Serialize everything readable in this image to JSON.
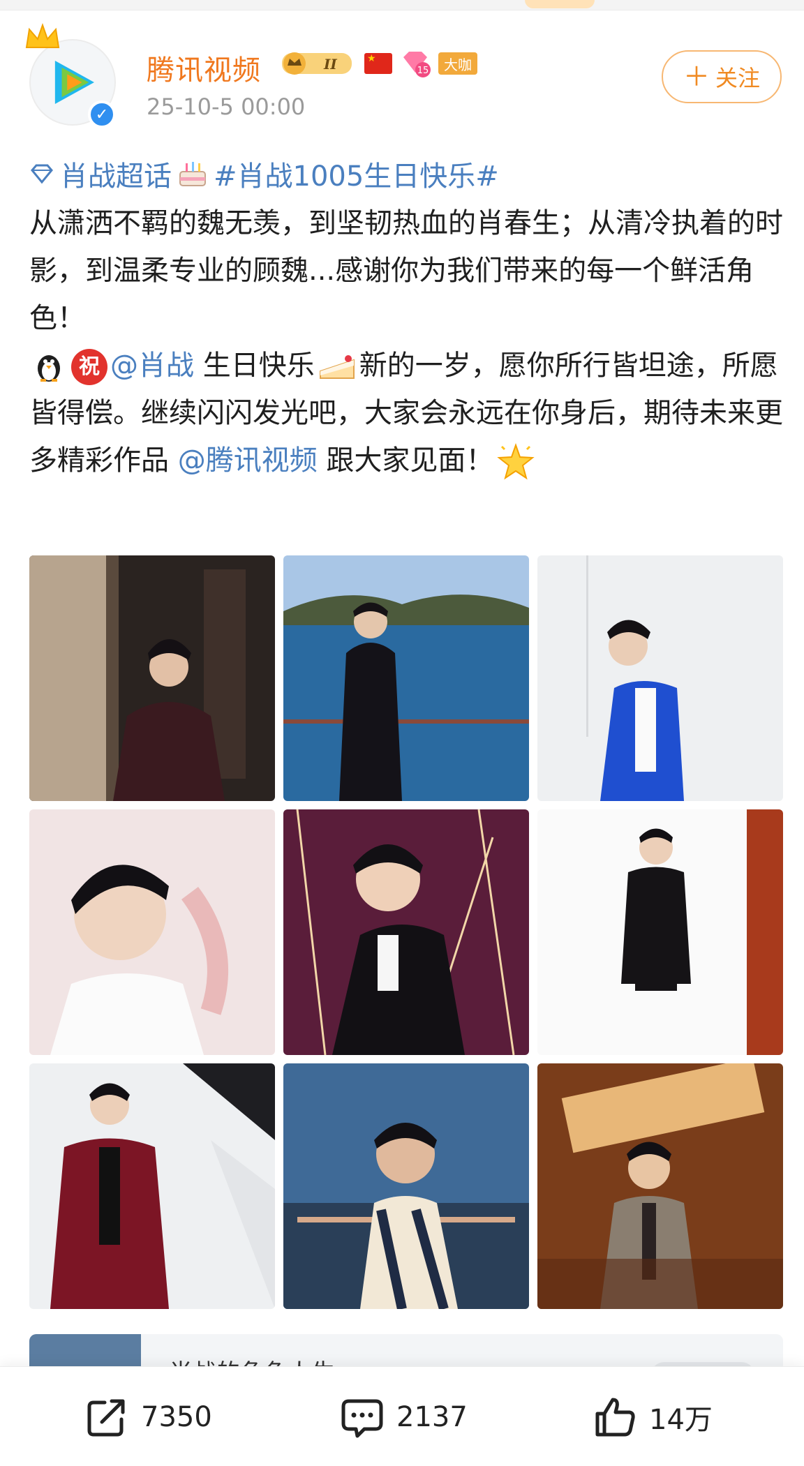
{
  "author": {
    "name": "腾讯视频",
    "post_time": "25-10-5 00:00",
    "badge_level": "II",
    "badge_diamond_count": "15",
    "badge_daka": "大咖"
  },
  "follow_button": {
    "label": "关注",
    "plus": "＋"
  },
  "post": {
    "tag_topic": "肖战超话",
    "hashtag": "#肖战1005生日快乐#",
    "paragraph1": "从潇洒不羁的魏无羡，到坚韧热血的肖春生；从清冷执着的时影，到温柔专业的顾魏...感谢你为我们带来的每一个鲜活角色！",
    "zhu_char": "祝",
    "mention1": "@肖战",
    "text_birthday": " 生日快乐",
    "paragraph2_main": "新的一岁，愿你所行皆坦途，所愿皆得偿。继续闪闪发光吧，大家会永远在你身后，期待未来更多精彩作品",
    "mention2": "@腾讯视频",
    "paragraph2_end": " 跟大家见面！"
  },
  "link_card": {
    "title": "肖战的角色人生"
  },
  "actions": {
    "repost_count": "7350",
    "comment_count": "2137",
    "like_count": "14万"
  },
  "icons": [
    "crown-icon",
    "verified-icon",
    "flag-icon",
    "diamond-icon",
    "cake-icon",
    "penguin-icon",
    "slice-icon",
    "star-icon",
    "share-icon",
    "comment-icon",
    "like-icon"
  ],
  "colors": {
    "author": "#f0781e",
    "link": "#4a7fbf",
    "follow": "#f08a22",
    "time": "#9a9a9a"
  }
}
